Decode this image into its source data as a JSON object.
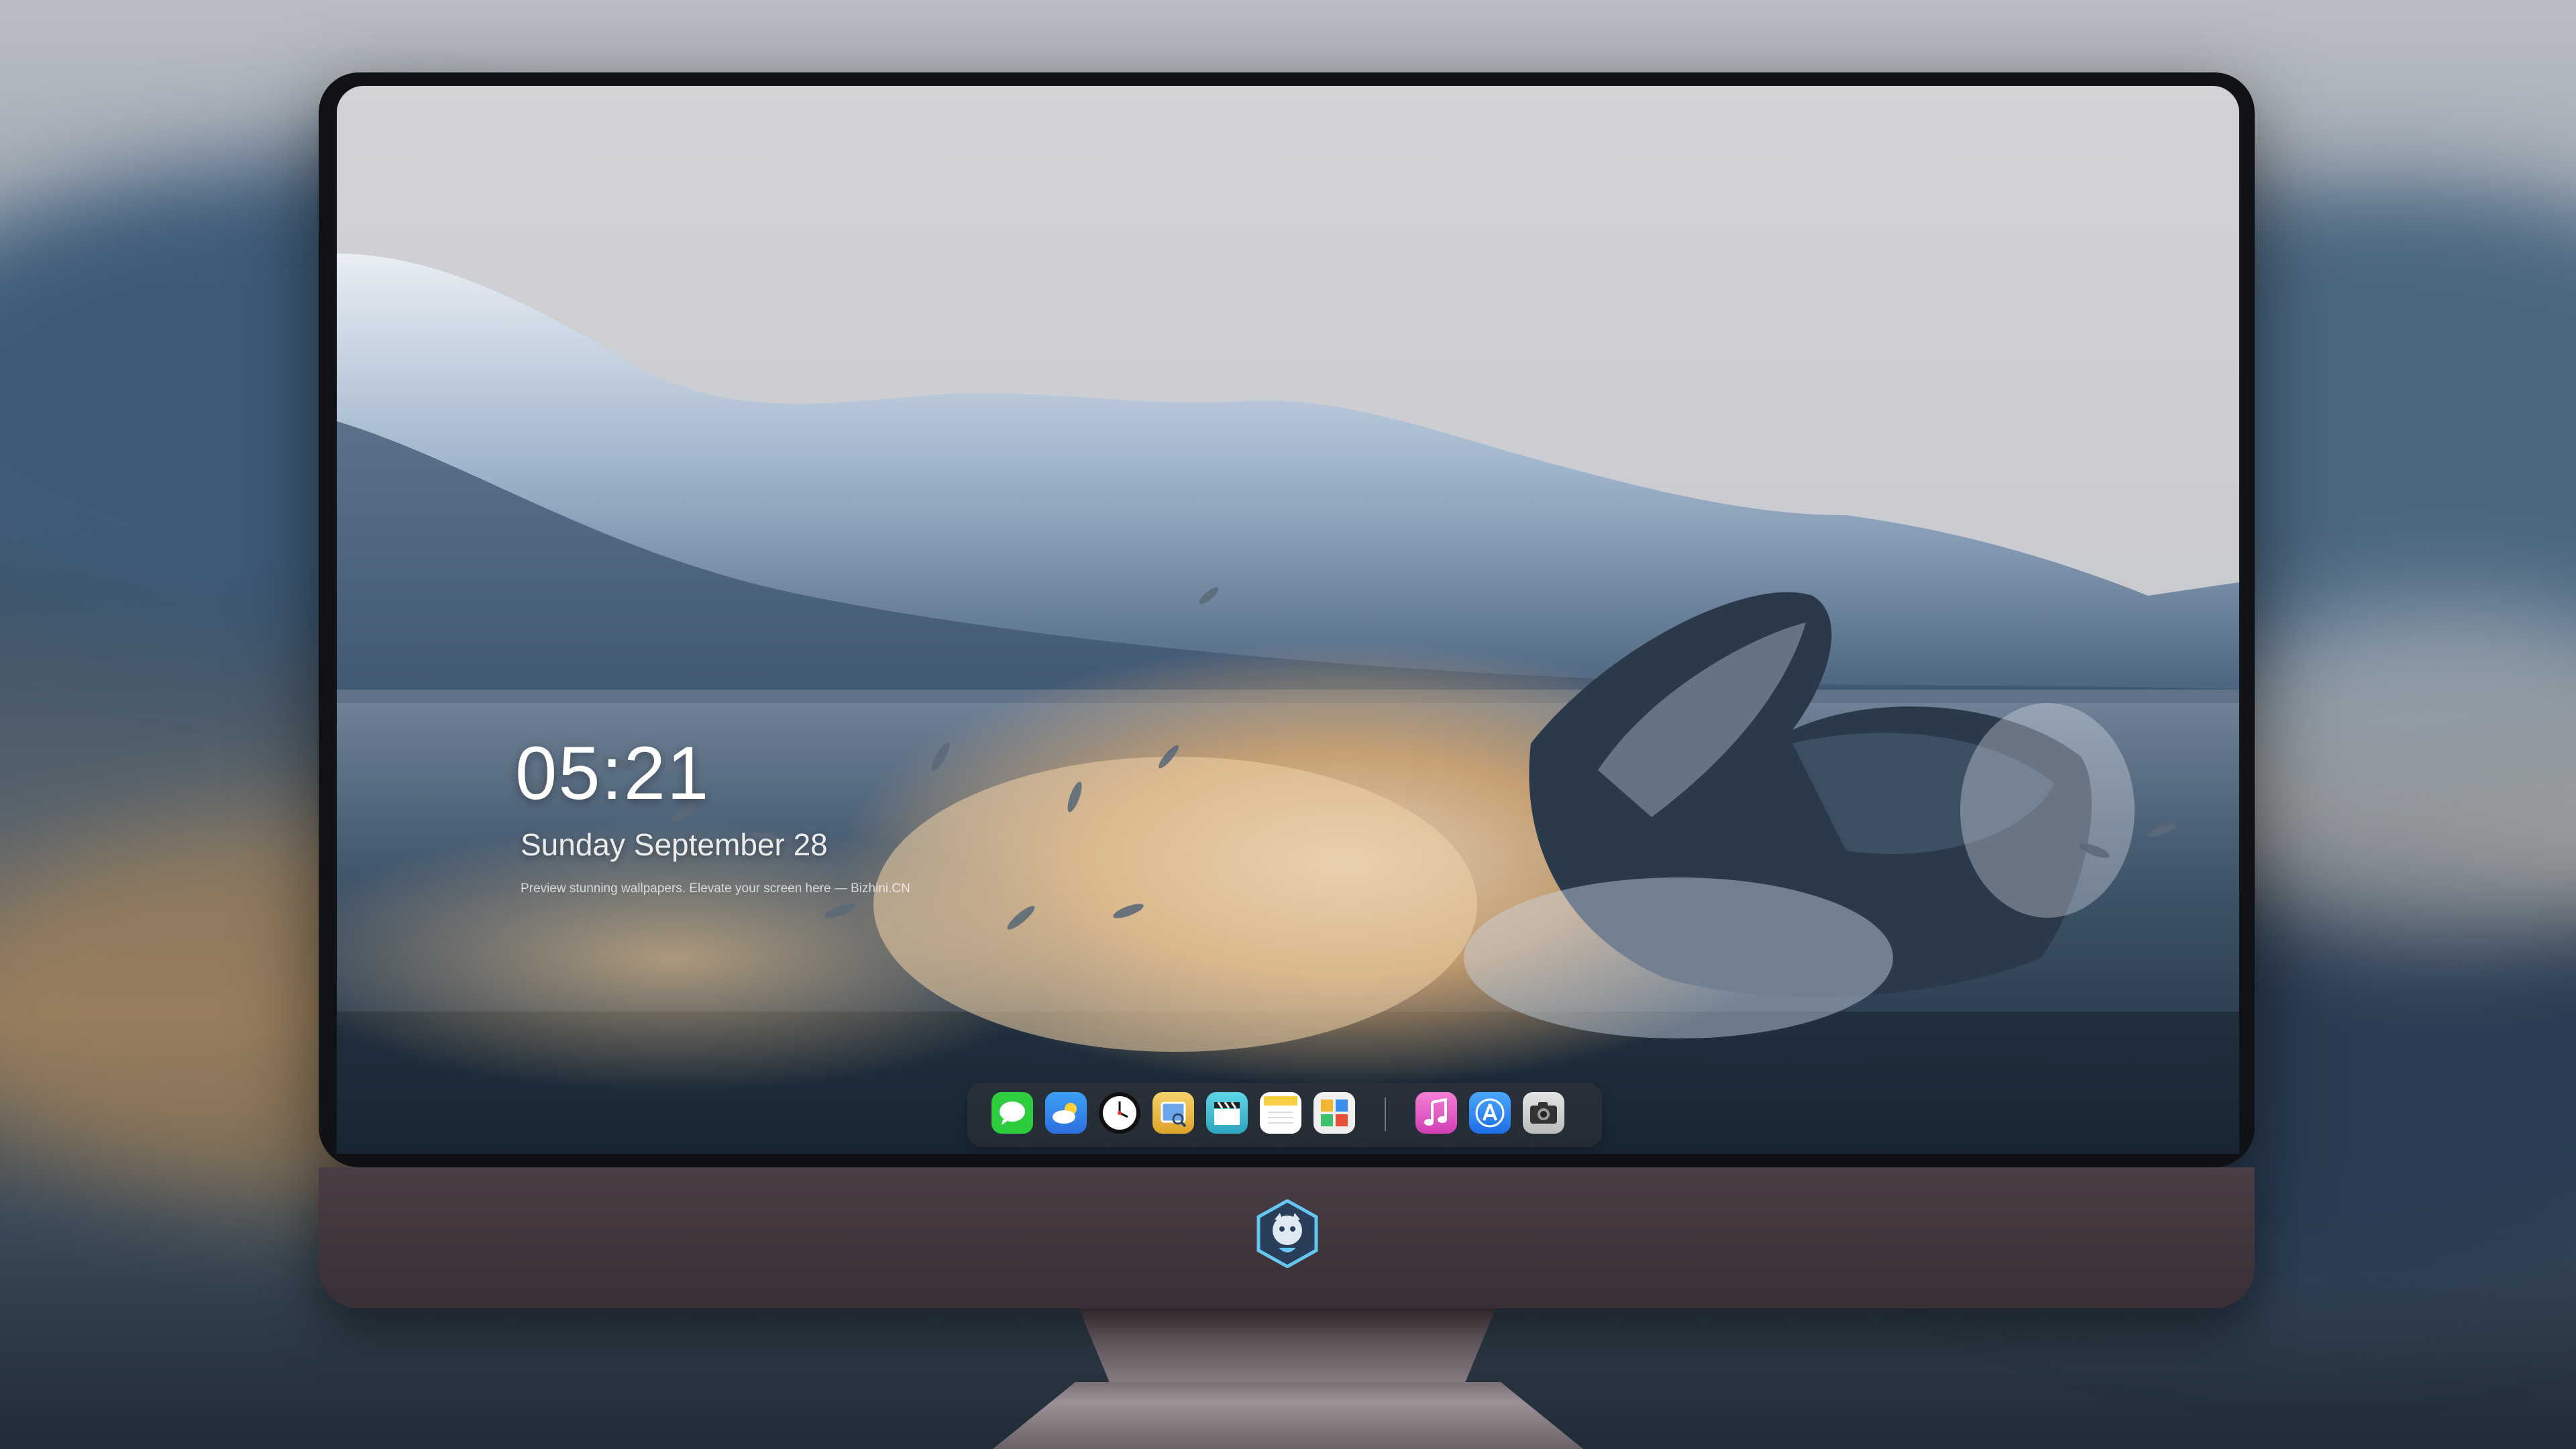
{
  "lock_screen": {
    "time": "05:21",
    "date": "Sunday September 28",
    "tagline": "Preview stunning wallpapers. Elevate your screen here — Bizhini.CN"
  },
  "dock": {
    "items": [
      {
        "name": "Messages",
        "icon": "messages-icon",
        "color": "#2ecc3f"
      },
      {
        "name": "Weather",
        "icon": "weather-icon",
        "color": "#3a8ef0"
      },
      {
        "name": "Clock",
        "icon": "clock-icon",
        "color": "#ffffff"
      },
      {
        "name": "Preview",
        "icon": "preview-icon",
        "color": "#e8b83a"
      },
      {
        "name": "Final Cut",
        "icon": "clapperboard-icon",
        "color": "#4ec6d8"
      },
      {
        "name": "Notes",
        "icon": "notes-icon",
        "color": "#f7cf43"
      },
      {
        "name": "Photo Grid",
        "icon": "photo-grid-icon",
        "color": "#f0f0f0"
      },
      {
        "name": "Music",
        "icon": "music-icon",
        "color": "#f065c6"
      },
      {
        "name": "App Store",
        "icon": "app-store-icon",
        "color": "#2f8bf5"
      },
      {
        "name": "Camera",
        "icon": "camera-icon",
        "color": "#d8d8d8"
      }
    ]
  },
  "colors": {
    "frame": "#101216",
    "chin": "#3a2f36",
    "sky": "#c9ccd2",
    "water": "#2a3d52"
  }
}
